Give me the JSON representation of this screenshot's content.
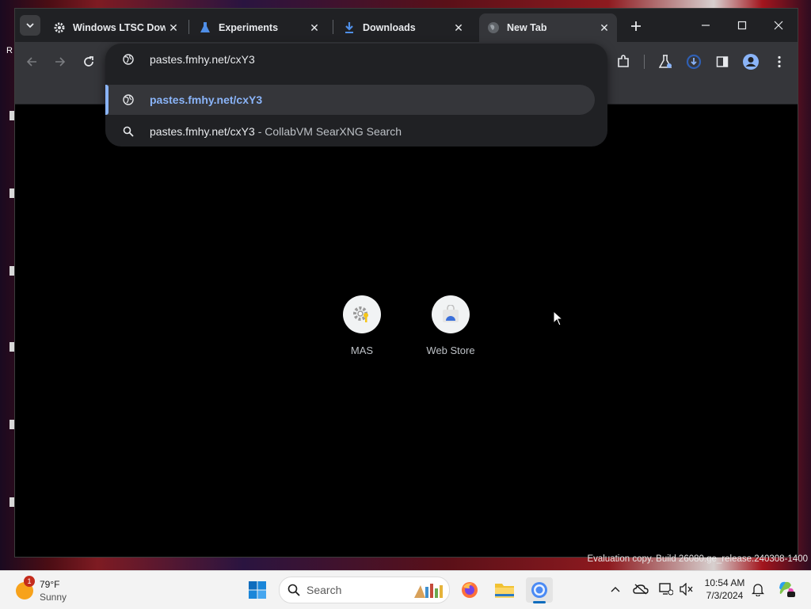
{
  "tabs": [
    {
      "title": "Windows LTSC Dow",
      "icon": "gear-icon",
      "active": false
    },
    {
      "title": "Experiments",
      "icon": "flask-icon",
      "active": false
    },
    {
      "title": "Downloads",
      "icon": "download-icon",
      "active": false
    },
    {
      "title": "New Tab",
      "icon": "globe-icon",
      "active": true
    }
  ],
  "omnibox": {
    "value": "pastes.fmhy.net/cxY3",
    "suggestions": [
      {
        "main": "pastes.fmhy.net/cxY3",
        "detail": "",
        "icon": "globe-icon",
        "selected": true
      },
      {
        "main": "pastes.fmhy.net/cxY3",
        "detail": "- CollabVM SearXNG Search",
        "icon": "search-icon",
        "selected": false
      }
    ]
  },
  "shortcuts": [
    {
      "label": "MAS",
      "icon": "gear-key-icon"
    },
    {
      "label": "Web Store",
      "icon": "web-store-icon"
    }
  ],
  "watermark": "Evaluation copy. Build 26080.ge_release.240308-1400",
  "taskbar": {
    "weather": {
      "temp": "79°F",
      "condition": "Sunny",
      "badge": "1"
    },
    "search_label": "Search",
    "time": "10:54 AM",
    "date": "7/3/2024"
  },
  "colors": {
    "tabstrip": "#202124",
    "toolbar": "#35363a",
    "accent": "#8ab4f8",
    "taskbar": "#f3f3f3"
  }
}
